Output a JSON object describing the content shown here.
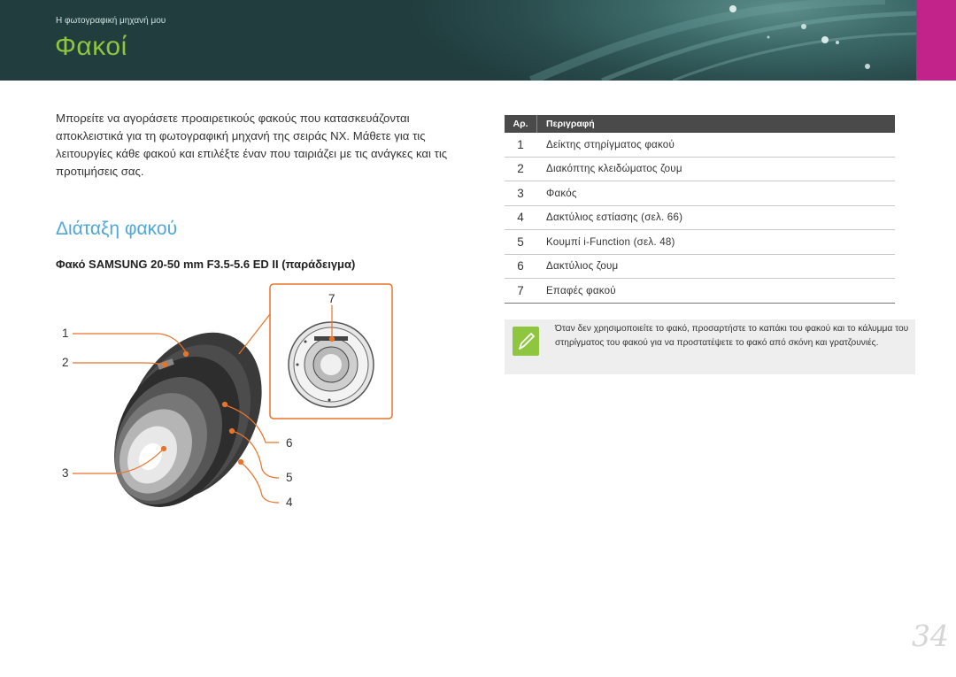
{
  "header": {
    "breadcrumb": "Η φωτογραφική μηχανή μου",
    "title": "Φακοί"
  },
  "intro": "Μπορείτε να αγοράσετε προαιρετικούς φακούς που κατασκευάζονται αποκλειστικά για τη φωτογραφική μηχανή της σειράς NX. Μάθετε για τις λειτουργίες κάθε φακού και επιλέξτε έναν που ταιριάζει με τις ανάγκες και τις προτιμήσεις σας.",
  "section": {
    "title": "Διάταξη φακού",
    "subtitle": "Φακό SAMSUNG 20-50 mm F3.5-5.6 ED II (παράδειγμα)"
  },
  "callouts": [
    "1",
    "2",
    "3",
    "4",
    "5",
    "6",
    "7"
  ],
  "table": {
    "headers": [
      "Αρ.",
      "Περιγραφή"
    ],
    "rows": [
      {
        "num": "1",
        "desc": "Δείκτης στηρίγματος φακού"
      },
      {
        "num": "2",
        "desc": "Διακόπτης κλειδώματος ζουμ"
      },
      {
        "num": "3",
        "desc": "Φακός"
      },
      {
        "num": "4",
        "desc": "Δακτύλιος εστίασης (σελ. 66)"
      },
      {
        "num": "5",
        "desc": "Κουμπί i-Function (σελ. 48)"
      },
      {
        "num": "6",
        "desc": "Δακτύλιος ζουμ"
      },
      {
        "num": "7",
        "desc": "Επαφές φακού"
      }
    ]
  },
  "note": {
    "icon": "pencil-note-icon",
    "text": "Όταν δεν χρησιμοποιείτε το φακό, προσαρτήστε το καπάκι του φακού και το κάλυμμα του στηρίγματος του φακού για να προστατέψετε το φακό από σκόνη και γρατζουνιές."
  },
  "page_number": "34",
  "colors": {
    "title": "#8ec63f",
    "section": "#4fa8d8",
    "callout_line": "#e8742a",
    "tab": "#c2238b"
  }
}
